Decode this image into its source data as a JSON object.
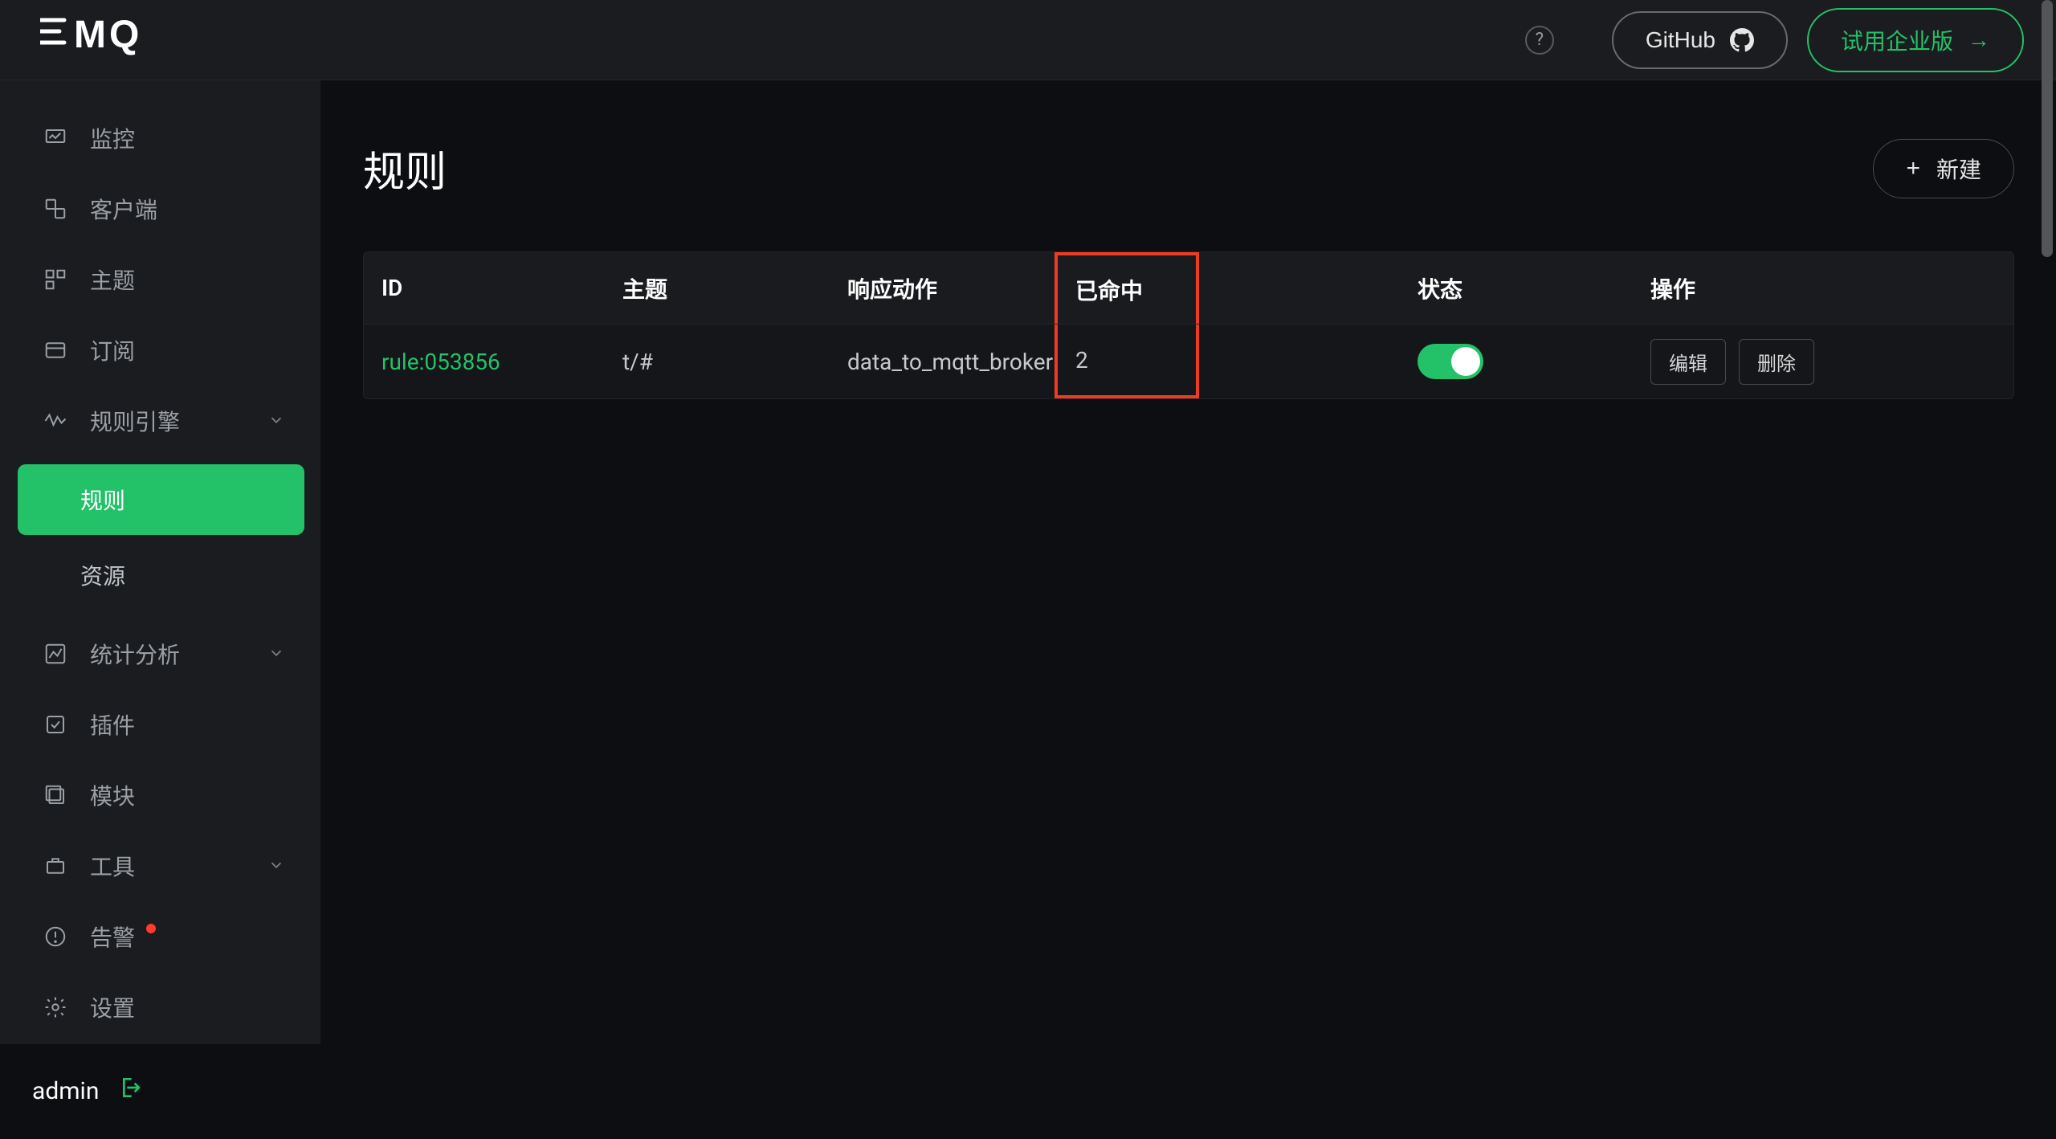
{
  "brand": "EMQ",
  "topbar": {
    "github_label": "GitHub",
    "trial_label": "试用企业版"
  },
  "sidebar": {
    "items": [
      {
        "key": "monitor",
        "label": "监控"
      },
      {
        "key": "clients",
        "label": "客户端"
      },
      {
        "key": "topics",
        "label": "主题"
      },
      {
        "key": "subscriptions",
        "label": "订阅"
      },
      {
        "key": "rule-engine",
        "label": "规则引擎",
        "expandable": true,
        "expanded": true,
        "children": [
          {
            "key": "rule",
            "label": "规则",
            "active": true
          },
          {
            "key": "resource",
            "label": "资源"
          }
        ]
      },
      {
        "key": "analytics",
        "label": "统计分析",
        "expandable": true
      },
      {
        "key": "plugins",
        "label": "插件"
      },
      {
        "key": "modules",
        "label": "模块"
      },
      {
        "key": "tools",
        "label": "工具",
        "expandable": true
      },
      {
        "key": "alerts",
        "label": "告警",
        "badge": true
      },
      {
        "key": "settings",
        "label": "设置"
      }
    ],
    "footer_user": "admin"
  },
  "page": {
    "title": "规则",
    "create_label": "新建",
    "columns": {
      "id": "ID",
      "topic": "主题",
      "action": "响应动作",
      "hits": "已命中",
      "status": "状态",
      "ops": "操作"
    },
    "rows": [
      {
        "id": "rule:053856",
        "topic": "t/#",
        "action": "data_to_mqtt_broker",
        "hits": "2",
        "status_on": true,
        "edit_label": "编辑",
        "delete_label": "删除"
      }
    ]
  }
}
